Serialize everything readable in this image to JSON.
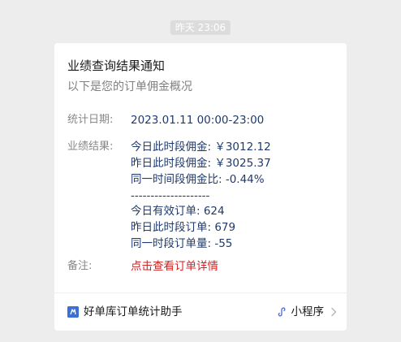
{
  "timestamp": "昨天  23:06",
  "card": {
    "title": "业绩查询结果通知",
    "subtitle": "以下是您的订单佣金概况",
    "date_label": "统计日期:",
    "date_value": "2023.01.11 00:00-23:00",
    "result_label": "业绩结果:",
    "result_lines": [
      "今日此时段佣金: ￥3012.12",
      "昨日此时段佣金: ￥3025.37",
      "同一时间段佣金比: -0.44%",
      "--------------------",
      "今日有效订单: 624",
      "昨日此时段订单: 679",
      "同一时段订单量: -55"
    ],
    "remark_label": "备注:",
    "remark_link": "点击查看订单详情",
    "link_color": "#d42020"
  },
  "footer": {
    "app_name": "好单库订单统计助手",
    "app_icon": "app-logo-icon",
    "mini_program_icon": "mini-program-icon",
    "mini_program_label": "小程序",
    "chevron_icon": "chevron-right-icon"
  }
}
